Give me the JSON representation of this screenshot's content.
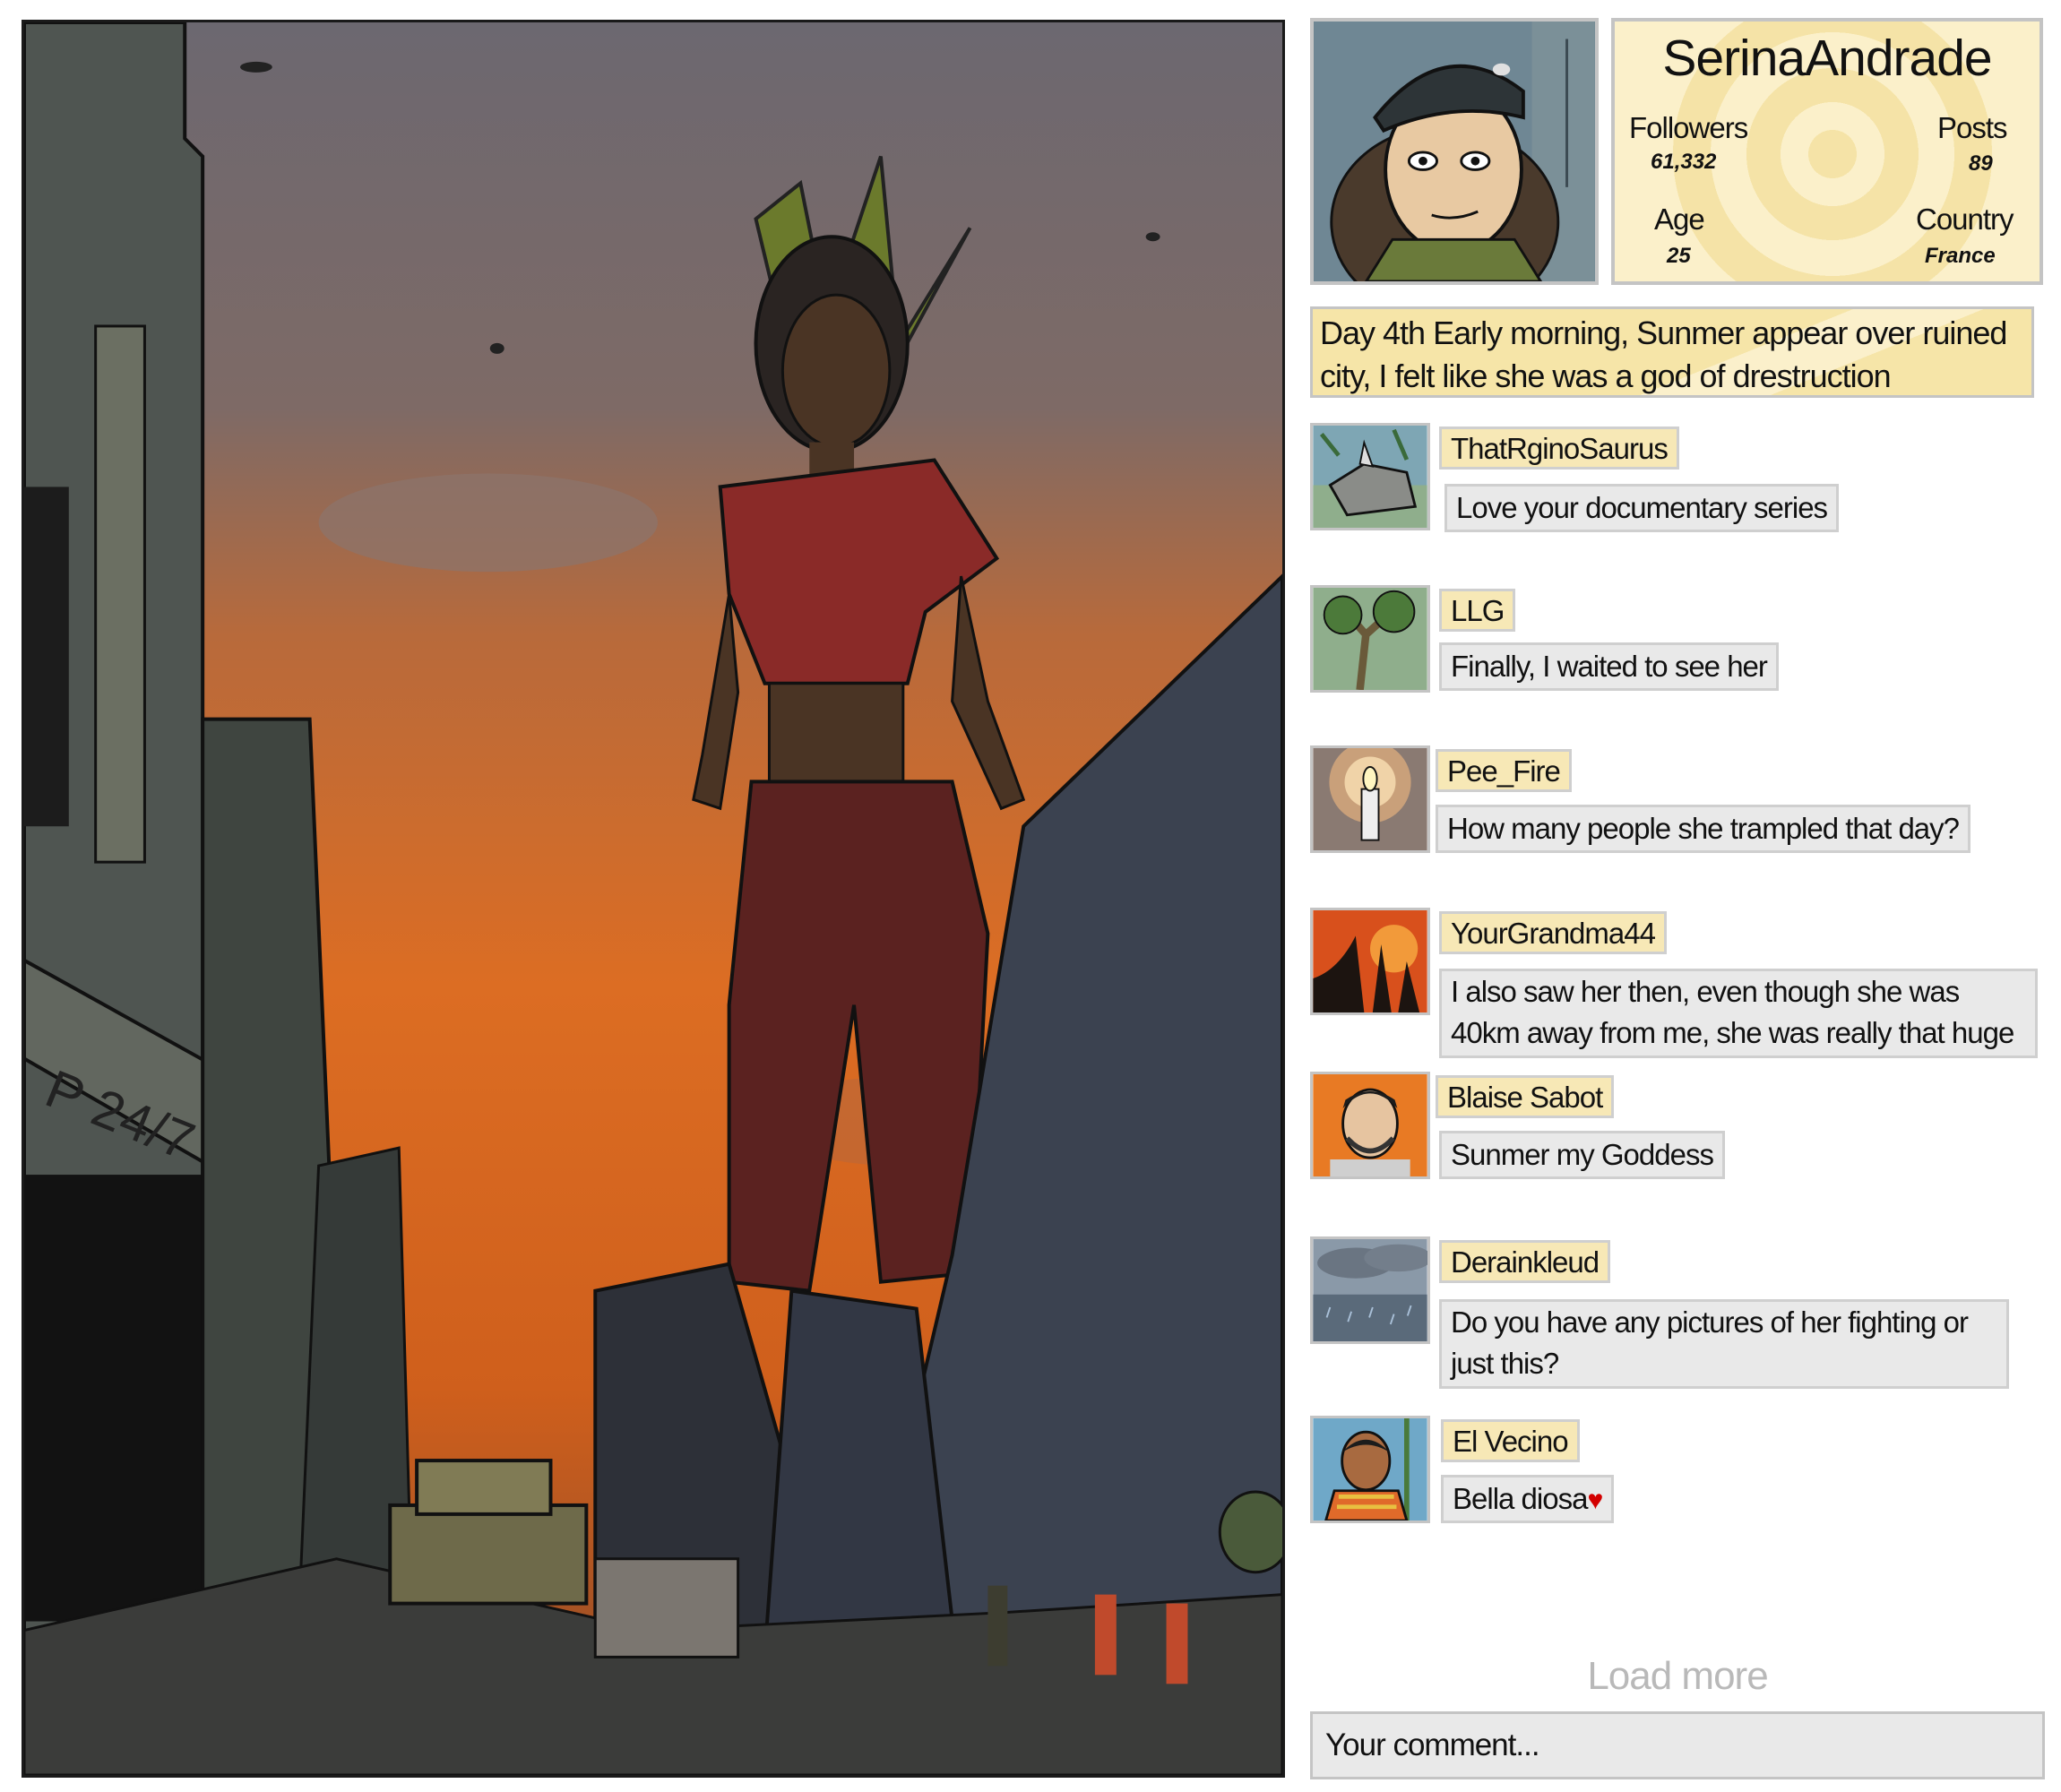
{
  "profile": {
    "username": "SerinaAndrade",
    "followers_label": "Followers",
    "followers_value": "61,332",
    "posts_label": "Posts",
    "posts_value": "89",
    "age_label": "Age",
    "age_value": "25",
    "country_label": "Country",
    "country_value": "France"
  },
  "post": {
    "text": "Day 4th Early morning, Sunmer appear over ruined city, I felt like she was a god of drestruction"
  },
  "comments": [
    {
      "user": "ThatRginoSaurus",
      "text": "Love your documentary series",
      "avatar": "rhino-avatar"
    },
    {
      "user": "LLG",
      "text": "Finally, I waited to see her",
      "avatar": "tree-avatar"
    },
    {
      "user": "Pee_Fire",
      "text": "How many people she trampled that day?",
      "avatar": "candle-avatar"
    },
    {
      "user": "YourGrandma44",
      "text": "I also saw her then, even though she was 40km away from me, she was really that huge",
      "avatar": "sunset-silhouette-avatar"
    },
    {
      "user": "Blaise Sabot",
      "text": "Sunmer my Goddess",
      "avatar": "man-portrait-avatar"
    },
    {
      "user": "Derainkleud",
      "text": "Do you have any pictures of her fighting or just this?",
      "avatar": "rain-cloud-avatar"
    },
    {
      "user": "El Vecino",
      "text": "Bella diosa",
      "avatar": "man-with-vest-avatar"
    }
  ],
  "load_more_label": "Load more",
  "comment_input": {
    "placeholder": "Your comment..."
  },
  "artwork": {
    "sign_text": "P 24/7"
  },
  "colors": {
    "username_tag": "#f7e8b6",
    "comment_bubble": "#e9e9e9",
    "post_background": "#f6e5a8",
    "load_more_text": "#b9b9b9",
    "heart": "#d30000"
  }
}
